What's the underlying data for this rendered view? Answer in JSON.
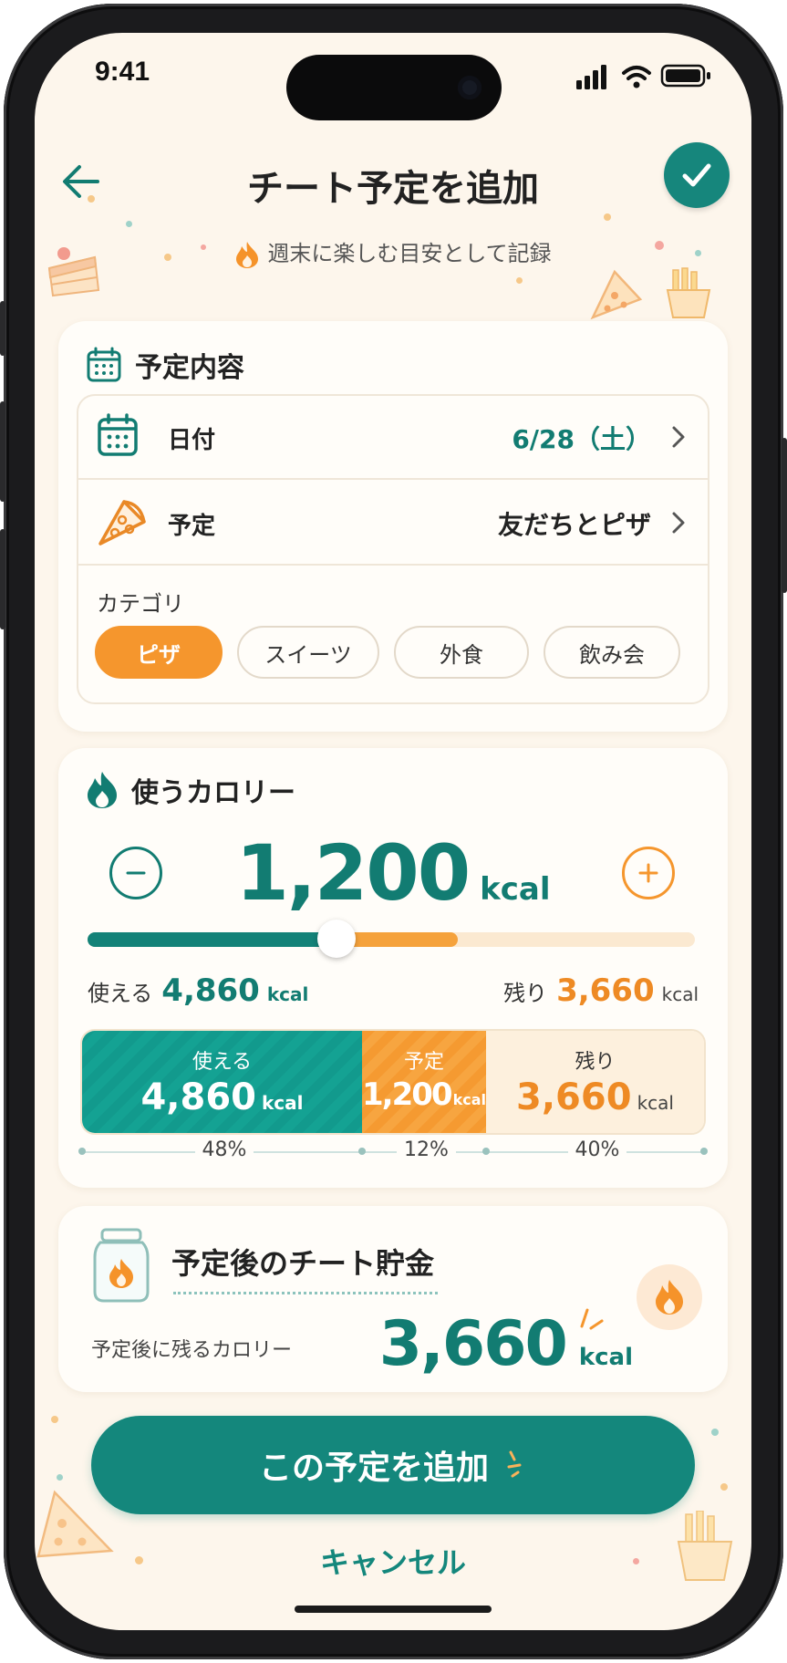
{
  "status_bar": {
    "time": "9:41",
    "signal_icon": "signal-icon",
    "wifi_icon": "wifi-icon",
    "battery_icon": "battery-icon"
  },
  "header": {
    "title": "チート予定を追加",
    "back_icon": "arrow-left-icon",
    "confirm_icon": "check-icon"
  },
  "subtitle": "週末に楽しむ目安として記録",
  "plan_card": {
    "title": "予定内容",
    "date": {
      "label": "日付",
      "value": "6/28（土）"
    },
    "plan": {
      "label": "予定",
      "value": "友だちとピザ"
    },
    "category_label": "カテゴリ",
    "categories": [
      "ピザ",
      "スイーツ",
      "外食",
      "飲み会"
    ],
    "selected_category": "ピザ"
  },
  "calorie_card": {
    "title": "使うカロリー",
    "value": "1,200",
    "unit": "kcal",
    "available_label": "使える",
    "available_value": "4,860",
    "remaining_label": "残り",
    "remaining_value": "3,660",
    "breakdown": [
      {
        "label": "使える",
        "value": "4,860",
        "unit": "kcal",
        "pct": "48%",
        "share": 0.45
      },
      {
        "label": "予定",
        "value": "1,200",
        "unit": "kcal",
        "pct": "12%",
        "share": 0.2
      },
      {
        "label": "残り",
        "value": "3,660",
        "unit": "kcal",
        "pct": "40%",
        "share": 0.35
      }
    ],
    "slider_fraction": 0.41,
    "slider_planned_fraction": 0.2
  },
  "savings_card": {
    "title": "予定後のチート貯金",
    "label": "予定後に残るカロリー",
    "value": "3,660",
    "unit": "kcal"
  },
  "actions": {
    "add_label": "この予定を追加",
    "cancel_label": "キャンセル"
  },
  "colors": {
    "teal": "#127c72",
    "orange": "#f5962d",
    "background": "#fdf6ec"
  }
}
